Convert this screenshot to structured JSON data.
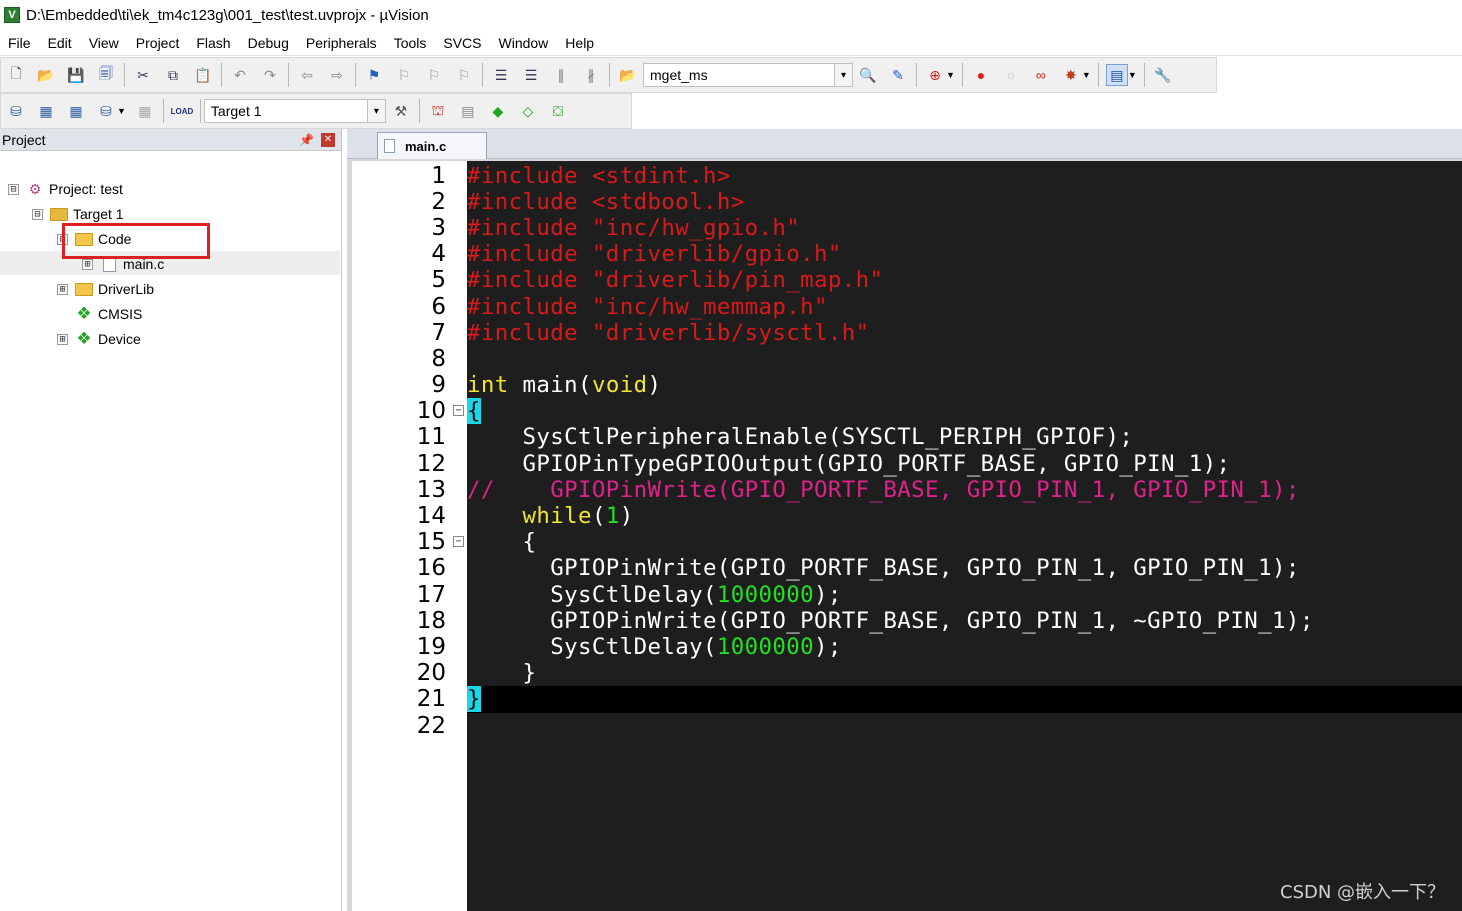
{
  "window": {
    "title": "D:\\Embedded\\ti\\ek_tm4c123g\\001_test\\test.uvprojx - µVision",
    "app_icon_letter": "V"
  },
  "menu": [
    "File",
    "Edit",
    "View",
    "Project",
    "Flash",
    "Debug",
    "Peripherals",
    "Tools",
    "SVCS",
    "Window",
    "Help"
  ],
  "toolbar": {
    "find_value": "mget_ms",
    "target_value": "Target 1",
    "load_label": "LOAD"
  },
  "project_panel": {
    "title": "Project",
    "tree": [
      {
        "label": "Project: test",
        "expander": "⊟",
        "icon": "project-icon"
      },
      {
        "label": "Target 1",
        "expander": "⊟",
        "icon": "target-icon"
      },
      {
        "label": "Code",
        "expander": "⊟",
        "icon": "folder-icon"
      },
      {
        "label": "main.c",
        "expander": "⊞",
        "icon": "file-icon"
      },
      {
        "label": "DriverLib",
        "expander": "⊞",
        "icon": "folder-icon"
      },
      {
        "label": "CMSIS",
        "expander": "",
        "icon": "component-icon"
      },
      {
        "label": "Device",
        "expander": "⊞",
        "icon": "component-icon"
      }
    ]
  },
  "editor": {
    "tab_label": "main.c",
    "line_numbers": [
      "1",
      "2",
      "3",
      "4",
      "5",
      "6",
      "7",
      "8",
      "9",
      "10",
      "11",
      "12",
      "13",
      "14",
      "15",
      "16",
      "17",
      "18",
      "19",
      "20",
      "21",
      "22"
    ],
    "lines": {
      "l1_pp": "#include",
      "l1_arg": " <stdint.h>",
      "l2_pp": "#include",
      "l2_arg": " <stdbool.h>",
      "l3_pp": "#include",
      "l3_arg": " \"inc/hw_gpio.h\"",
      "l4_pp": "#include",
      "l4_arg": " \"driverlib/gpio.h\"",
      "l5_pp": "#include",
      "l5_arg": " \"driverlib/pin_map.h\"",
      "l6_pp": "#include",
      "l6_arg": " \"inc/hw_memmap.h\"",
      "l7_pp": "#include",
      "l7_arg": " \"driverlib/sysctl.h\"",
      "l9_kw1": "int",
      "l9_mid": " main(",
      "l9_kw2": "void",
      "l9_end": ")",
      "l10_brace": "{",
      "l11": "    SysCtlPeripheralEnable(SYSCTL_PERIPH_GPIOF);",
      "l12": "    GPIOPinTypeGPIOOutput(GPIO_PORTF_BASE, GPIO_PIN_1);",
      "l13": "//    GPIOPinWrite(GPIO_PORTF_BASE, GPIO_PIN_1, GPIO_PIN_1);",
      "l14_indent": "    ",
      "l14_kw": "while",
      "l14_open": "(",
      "l14_num": "1",
      "l14_close": ")",
      "l15": "    {",
      "l16": "      GPIOPinWrite(GPIO_PORTF_BASE, GPIO_PIN_1, GPIO_PIN_1);",
      "l17_pre": "      SysCtlDelay(",
      "l17_num": "1000000",
      "l17_post": ");",
      "l18": "      GPIOPinWrite(GPIO_PORTF_BASE, GPIO_PIN_1, ~GPIO_PIN_1);",
      "l19_pre": "      SysCtlDelay(",
      "l19_num": "1000000",
      "l19_post": ");",
      "l20": "    }",
      "l21_brace": "}"
    }
  },
  "watermark": "CSDN @嵌入一下？"
}
